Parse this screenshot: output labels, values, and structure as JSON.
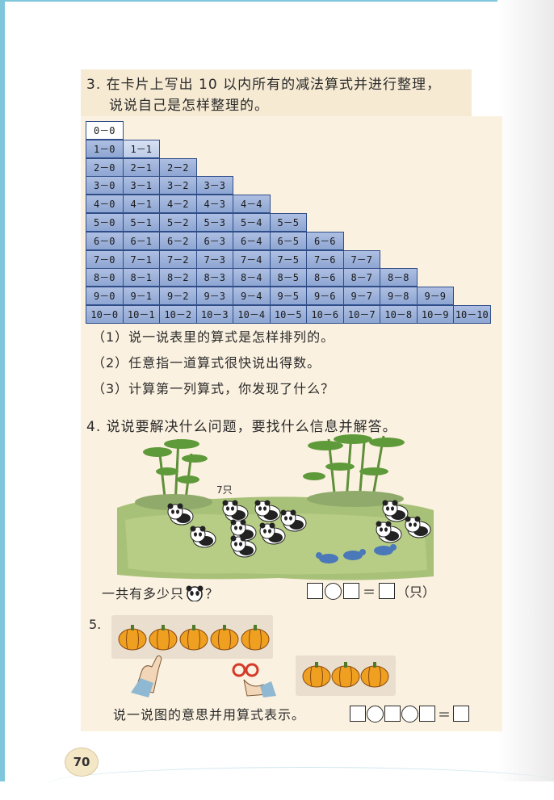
{
  "section3": {
    "title_line1": "3. 在卡片上写出 10 以内所有的减法算式并进行整理，",
    "title_line2": "说说自己是怎样整理的。",
    "rows": [
      [
        "0－0"
      ],
      [
        "1－0",
        "1－1"
      ],
      [
        "2－0",
        "2－1",
        "2－2"
      ],
      [
        "3－0",
        "3－1",
        "3－2",
        "3－3"
      ],
      [
        "4－0",
        "4－1",
        "4－2",
        "4－3",
        "4－4"
      ],
      [
        "5－0",
        "5－1",
        "5－2",
        "5－3",
        "5－4",
        "5－5"
      ],
      [
        "6－0",
        "6－1",
        "6－2",
        "6－3",
        "6－4",
        "6－5",
        "6－6"
      ],
      [
        "7－0",
        "7－1",
        "7－2",
        "7－3",
        "7－4",
        "7－5",
        "7－6",
        "7－7"
      ],
      [
        "8－0",
        "8－1",
        "8－2",
        "8－3",
        "8－4",
        "8－5",
        "8－6",
        "8－7",
        "8－8"
      ],
      [
        "9－0",
        "9－1",
        "9－2",
        "9－3",
        "9－4",
        "9－5",
        "9－6",
        "9－7",
        "9－8",
        "9－9"
      ],
      [
        "10－0",
        "10－1",
        "10－2",
        "10－3",
        "10－4",
        "10－5",
        "10－6",
        "10－7",
        "10－8",
        "10－9",
        "10－10"
      ]
    ],
    "sub1": "（1）说一说表里的算式是怎样排列的。",
    "sub2": "（2）任意指一道算式很快说出得数。",
    "sub3": "（3）计算第一列算式，你发现了什么？"
  },
  "section4": {
    "title": "4. 说说要解决什么问题，要找什么信息并解答。",
    "label_7": "7只",
    "question_prefix": "一共有多少只",
    "question_suffix": "？",
    "eq_equals": "＝",
    "eq_unit": "（只）"
  },
  "section5": {
    "number": "5.",
    "describe": "说一说图的意思并用算式表示。",
    "eq_equals": "＝"
  },
  "page_number": "70"
}
